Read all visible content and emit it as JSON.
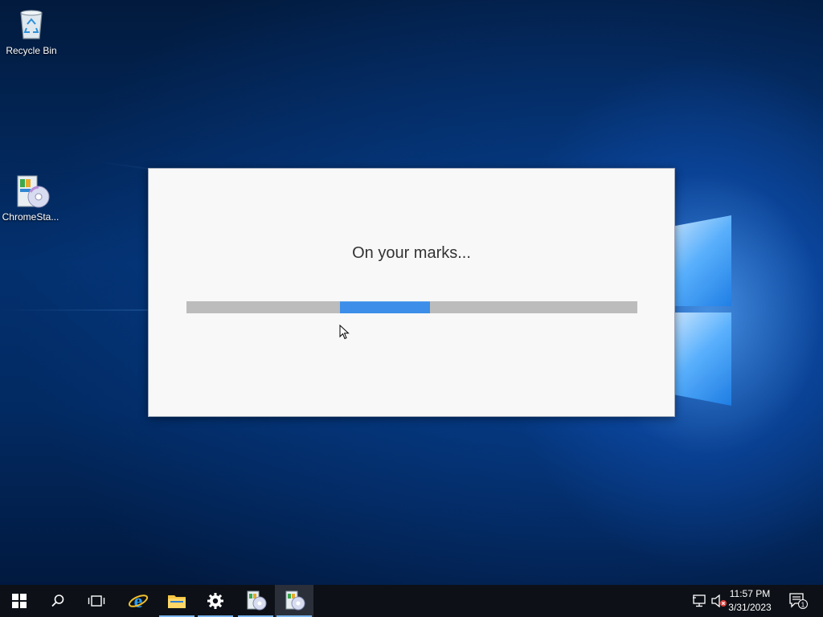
{
  "desktop": {
    "icons": [
      {
        "label": "Recycle Bin",
        "icon": "recycle-bin-icon"
      },
      {
        "label": "ChromeSta...",
        "icon": "installer-icon"
      }
    ]
  },
  "dialog": {
    "message": "On your marks...",
    "progress": {
      "fill_start_fraction": 0.34,
      "fill_fraction": 0.2,
      "indeterminate": true
    },
    "colors": {
      "fill": "#3c8ee8",
      "track": "#bcbcbc",
      "background": "#f8f8f8"
    }
  },
  "taskbar": {
    "pinned": [
      {
        "name": "start-button",
        "icon": "windows-logo-icon"
      },
      {
        "name": "search-button",
        "icon": "search-icon"
      },
      {
        "name": "task-view-button",
        "icon": "task-view-icon"
      },
      {
        "name": "internet-explorer",
        "icon": "internet-explorer-icon"
      },
      {
        "name": "file-explorer",
        "icon": "folder-icon"
      },
      {
        "name": "settings",
        "icon": "gear-icon"
      },
      {
        "name": "installer-app-1",
        "icon": "installer-icon"
      },
      {
        "name": "installer-app-2",
        "icon": "installer-icon"
      }
    ],
    "tray": {
      "network_icon": "network-icon",
      "volume_icon": "volume-muted-icon",
      "time": "11:57 PM",
      "date": "3/31/2023",
      "notifications_icon": "action-center-icon",
      "notification_count": "1"
    }
  }
}
